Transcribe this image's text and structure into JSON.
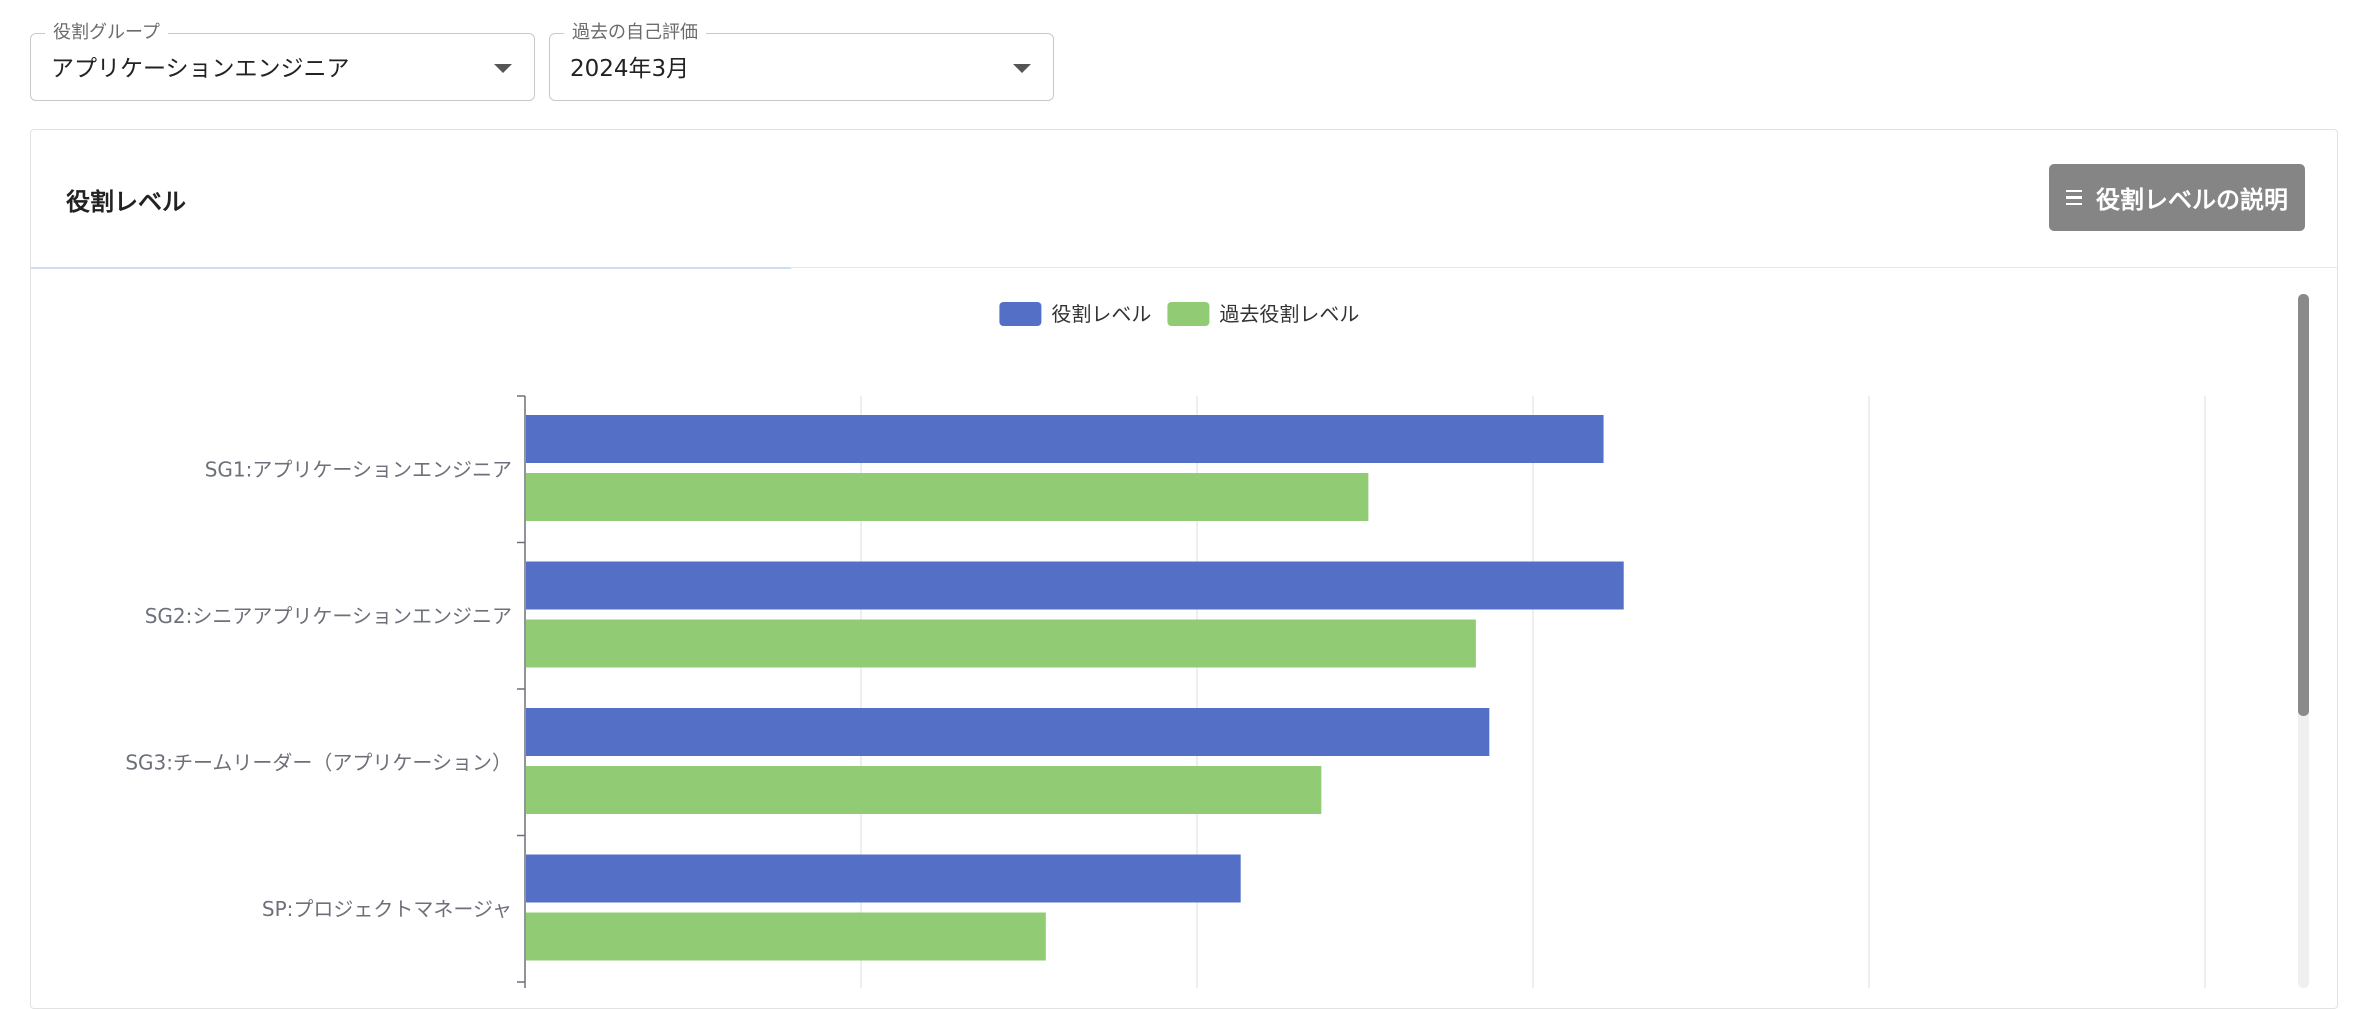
{
  "filters": {
    "role_group": {
      "label": "役割グループ",
      "value": "アプリケーションエンジニア"
    },
    "past_evaluation": {
      "label": "過去の自己評価",
      "value": "2024年3月"
    }
  },
  "card": {
    "title": "役割レベル",
    "help_button_label": "役割レベルの説明"
  },
  "chart_data": {
    "type": "bar",
    "orientation": "horizontal",
    "title": "",
    "categories": [
      "SG1:アプリケーションエンジニア",
      "SG2:シニアアプリケーションエンジニア",
      "SG3:チームリーダー（アプリケーション）",
      "SP:プロジェクトマネージャ"
    ],
    "series": [
      {
        "name": "役割レベル",
        "color": "#5470c6",
        "values": [
          3.21,
          3.27,
          2.87,
          2.13
        ]
      },
      {
        "name": "過去役割レベル",
        "color": "#91cc75",
        "values": [
          2.51,
          2.83,
          2.37,
          1.55
        ]
      }
    ],
    "xlim": [
      0,
      5
    ],
    "grid": true,
    "legend_position": "top-center"
  }
}
